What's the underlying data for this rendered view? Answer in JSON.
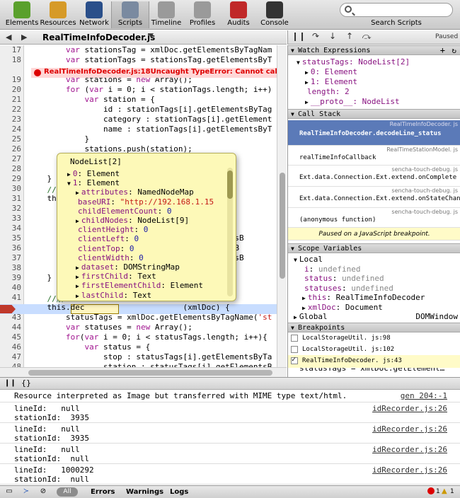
{
  "toolbar": {
    "tools": [
      {
        "label": "Elements",
        "icon": "elements-icon",
        "color": "#5aa02c"
      },
      {
        "label": "Resources",
        "icon": "resources-icon",
        "color": "#d69a28"
      },
      {
        "label": "Network",
        "icon": "network-icon",
        "color": "#2a4f8a"
      },
      {
        "label": "Scripts",
        "icon": "scripts-icon",
        "color": "#7a8aa0"
      },
      {
        "label": "Timeline",
        "icon": "timeline-icon",
        "color": "#9a9a9a"
      },
      {
        "label": "Profiles",
        "icon": "profiles-icon",
        "color": "#9a9a9a"
      },
      {
        "label": "Audits",
        "icon": "audits-icon",
        "color": "#c02828"
      },
      {
        "label": "Console",
        "icon": "console-icon",
        "color": "#333333"
      }
    ],
    "active_tool": "Scripts",
    "search_placeholder": "",
    "search_label": "Search Scripts"
  },
  "source": {
    "file_name": "RealTimeInfoDecoder.js",
    "error_text": "RealTimeInfoDecoder.js:18Uncaught TypeError: Cannot call m",
    "lines": [
      {
        "n": "17",
        "code": "        var stationsTag = xmlDoc.getElementsByTagNam"
      },
      {
        "n": "18",
        "code": "        var stationTags = stationsTag.getElementsByT"
      },
      {
        "n": "19",
        "code": "        var stations = new Array();"
      },
      {
        "n": "20",
        "code": "        for (var i = 0; i < stationTags.length; i++)"
      },
      {
        "n": "21",
        "code": "            var station = {"
      },
      {
        "n": "22",
        "code": "                id : stationTags[i].getElementsByTag"
      },
      {
        "n": "23",
        "code": "                category : stationTags[i].getElement"
      },
      {
        "n": "24",
        "code": "                name : stationTags[i].getElementsByT"
      },
      {
        "n": "25",
        "code": "            }"
      },
      {
        "n": "26",
        "code": "            stations.push(station);"
      },
      {
        "n": "27",
        "code": ""
      },
      {
        "n": "28",
        "code": ""
      },
      {
        "n": "29",
        "code": "    }"
      },
      {
        "n": "30",
        "code": "    // 解"
      },
      {
        "n": "31",
        "code": "    this."
      },
      {
        "n": "32",
        "code": "                                      sTagNa"
      },
      {
        "n": "33",
        "code": ""
      },
      {
        "n": "34",
        "code": "                                      sTagNa"
      },
      {
        "n": "35",
        "code": "                                      lementsB"
      },
      {
        "n": "36",
        "code": "                                      ementsB"
      },
      {
        "n": "37",
        "code": "                                      lementsB"
      },
      {
        "n": "38",
        "code": ""
      },
      {
        "n": "39",
        "code": "    }"
      },
      {
        "n": "40",
        "code": ""
      },
      {
        "n": "41",
        "code": "    //解"
      },
      {
        "n": "42",
        "code": "    this.dec                     (xmlDoc) {"
      },
      {
        "n": "43",
        "code": "        statusTags = xmlDoc.getElementsByTagName('st"
      },
      {
        "n": "44",
        "code": "        var statuses = new Array();"
      },
      {
        "n": "45",
        "code": "        for(var i = 0; i < statusTags.length; i++){"
      },
      {
        "n": "46",
        "code": "            var status = {"
      },
      {
        "n": "47",
        "code": "                stop : statusTags[i].getElementsByTa"
      },
      {
        "n": "48",
        "code": "                station : statusTags[i].getElementsB"
      },
      {
        "n": "49",
        "code": "                station_no : statusTags[i].getElemen"
      }
    ]
  },
  "popover": {
    "title": "NodeList[2]",
    "rows": [
      {
        "tri": "▶",
        "indent": 0,
        "key": "0",
        "sep": ": ",
        "val": "Element",
        "vtype": "plain"
      },
      {
        "tri": "▼",
        "indent": 0,
        "key": "1",
        "sep": ": ",
        "val": "Element",
        "vtype": "plain"
      },
      {
        "tri": "▶",
        "indent": 1,
        "key": "attributes",
        "sep": ": ",
        "val": "NamedNodeMap",
        "vtype": "plain"
      },
      {
        "tri": "",
        "indent": 1,
        "key": "baseURI",
        "sep": ": ",
        "val": "\"http://192.168.1.15",
        "vtype": "str"
      },
      {
        "tri": "",
        "indent": 1,
        "key": "childElementCount",
        "sep": ": ",
        "val": "0",
        "vtype": "num"
      },
      {
        "tri": "▶",
        "indent": 1,
        "key": "childNodes",
        "sep": ": ",
        "val": "NodeList[9]",
        "vtype": "plain"
      },
      {
        "tri": "",
        "indent": 1,
        "key": "clientHeight",
        "sep": ": ",
        "val": "0",
        "vtype": "num"
      },
      {
        "tri": "",
        "indent": 1,
        "key": "clientLeft",
        "sep": ": ",
        "val": "0",
        "vtype": "num"
      },
      {
        "tri": "",
        "indent": 1,
        "key": "clientTop",
        "sep": ": ",
        "val": "0",
        "vtype": "num"
      },
      {
        "tri": "",
        "indent": 1,
        "key": "clientWidth",
        "sep": ": ",
        "val": "0",
        "vtype": "num"
      },
      {
        "tri": "▶",
        "indent": 1,
        "key": "dataset",
        "sep": ": ",
        "val": "DOMStringMap",
        "vtype": "plain"
      },
      {
        "tri": "▶",
        "indent": 1,
        "key": "firstChild",
        "sep": ": ",
        "val": "Text",
        "vtype": "plain"
      },
      {
        "tri": "▶",
        "indent": 1,
        "key": "firstElementChild",
        "sep": ": ",
        "val": "Element",
        "vtype": "plain"
      },
      {
        "tri": "▶",
        "indent": 1,
        "key": "lastChild",
        "sep": ": ",
        "val": "Text",
        "vtype": "plain"
      }
    ]
  },
  "sidebar": {
    "paused_label": "Paused",
    "watch": {
      "header": "Watch Expressions",
      "rows": [
        {
          "tri": "▼",
          "indent": 0,
          "text": "statusTags: NodeList[2]"
        },
        {
          "tri": "▶",
          "indent": 1,
          "text": "0: Element"
        },
        {
          "tri": "▶",
          "indent": 1,
          "text": "1: Element"
        },
        {
          "tri": "",
          "indent": 1,
          "text": "length: 2"
        },
        {
          "tri": "▶",
          "indent": 1,
          "text": "__proto__: NodeList"
        }
      ]
    },
    "callstack": {
      "header": "Call Stack",
      "items": [
        {
          "file": "RealTimeInfoDecoder. js",
          "fn": "RealTimeInfoDecoder.decodeLine_status",
          "selected": true
        },
        {
          "file": "RealTimeStationModel. js",
          "fn": "realTimeInfoCallback",
          "selected": false
        },
        {
          "file": "sencha-touch-debug. js",
          "fn": "Ext.data.Connection.Ext.extend.onComplete",
          "selected": false
        },
        {
          "file": "sencha-touch-debug. js",
          "fn": "Ext.data.Connection.Ext.extend.onStateChange",
          "selected": false
        },
        {
          "file": "sencha-touch-debug. js",
          "fn": "(anonymous function)",
          "selected": false
        }
      ],
      "paused_msg": "Paused on a JavaScript breakpoint."
    },
    "scope": {
      "header": "Scope Variables",
      "rows": [
        {
          "tri": "▼",
          "indent": 0,
          "key": "Local",
          "val": ""
        },
        {
          "tri": "",
          "indent": 1,
          "key": "i",
          "val": "undefined"
        },
        {
          "tri": "",
          "indent": 1,
          "key": "status",
          "val": "undefined"
        },
        {
          "tri": "",
          "indent": 1,
          "key": "statuses",
          "val": "undefined"
        },
        {
          "tri": "▶",
          "indent": 1,
          "key": "this",
          "val": "RealTimeInfoDecoder"
        },
        {
          "tri": "▶",
          "indent": 1,
          "key": "xmlDoc",
          "val": "Document"
        },
        {
          "tri": "▶",
          "indent": 0,
          "key": "Global",
          "val": "DOMWindow"
        }
      ]
    },
    "breakpoints": {
      "header": "Breakpoints",
      "items": [
        {
          "file": "LocalStorageUtil. js:98",
          "checked": false
        },
        {
          "file": "LocalStorageUtil. js:102",
          "checked": false
        },
        {
          "file": "RealTimeInfoDecoder. js:43",
          "checked": true
        }
      ],
      "snippet": "statusTags = xmlDoc.getElement…"
    }
  },
  "console": {
    "messages": [
      {
        "text": "Resource interpreted as Image but transferred with MIME type text/html.",
        "src": "gen 204:-1",
        "lines": 1
      },
      {
        "text": "lineId:   null\nstationId:  3935",
        "src": "idRecorder.js:26",
        "lines": 2
      },
      {
        "text": "lineId:   null\nstationId:  3935",
        "src": "idRecorder.js:26",
        "lines": 2
      },
      {
        "text": "lineId:   null\nstationId:  null",
        "src": "idRecorder.js:26",
        "lines": 2
      },
      {
        "text": "lineId:   1000292\nstationId:  null",
        "src": "idRecorder.js:26",
        "lines": 2
      }
    ]
  },
  "statusbar": {
    "all_label": "All",
    "filters": [
      "Errors",
      "Warnings",
      "Logs"
    ],
    "error_count": "1",
    "warning_count": "1"
  },
  "colors": {
    "error_red": "#d00000",
    "selection_blue": "#5b7ab8",
    "popover_yellow": "#fdf9b8",
    "exec_line": "#c8ddff"
  }
}
